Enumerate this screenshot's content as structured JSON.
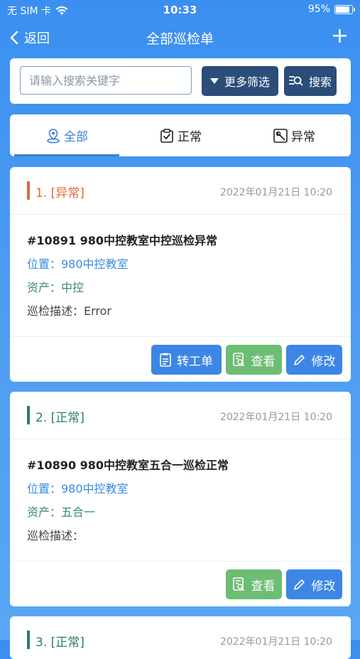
{
  "status": {
    "carrier": "无 SIM 卡",
    "time": "10:33",
    "battery": "95%"
  },
  "nav": {
    "back_label": "返回",
    "title": "全部巡检单",
    "add_symbol": "+"
  },
  "search": {
    "placeholder": "请输入搜索关键字",
    "filter_label": "更多筛选",
    "search_label": "搜索"
  },
  "tabs": [
    {
      "label": "全部",
      "icon": "location-pin-icon",
      "active": true
    },
    {
      "label": "正常",
      "icon": "clipboard-check-icon",
      "active": false
    },
    {
      "label": "异常",
      "icon": "wrench-icon",
      "active": false
    }
  ],
  "colors": {
    "accent": "#3d7fd6",
    "dark_button": "#2b4d7a",
    "abnormal": "#e0683a",
    "normal": "#2e7d66",
    "view_button": "#6dbd72",
    "edit_button": "#3d86e6"
  },
  "records": [
    {
      "label": "1. [异常]",
      "status": "abnormal",
      "date": "2022年01月21日 10:20",
      "title": "#10891 980中控教室中控巡检异常",
      "location": "位置：980中控教室",
      "asset": "资产：中控",
      "description": "巡检描述：Error",
      "actions": [
        "转工单",
        "查看",
        "修改"
      ]
    },
    {
      "label": "2. [正常]",
      "status": "normal",
      "date": "2022年01月21日 10:20",
      "title": "#10890 980中控教室五合一巡检正常",
      "location": "位置：980中控教室",
      "asset": "资产：五合一",
      "description": "巡检描述：",
      "actions": [
        "查看",
        "修改"
      ]
    },
    {
      "label": "3. [正常]",
      "status": "normal",
      "date": "2022年01月21日 10:20"
    }
  ]
}
